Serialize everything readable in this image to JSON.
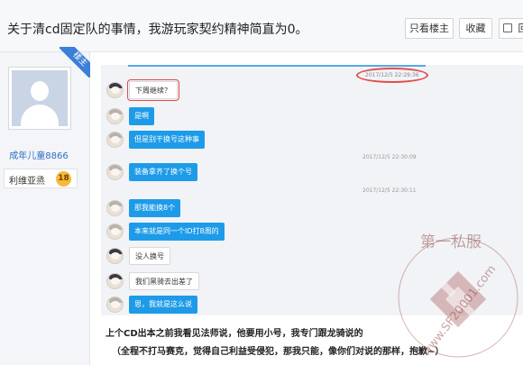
{
  "post": {
    "title": "关于清cd固定队的事情，我游玩家契约精神简直为0。"
  },
  "toolbar": {
    "only_op_label": "只看楼主",
    "favorite_label": "收藏",
    "reply_label": "回"
  },
  "user": {
    "ribbon": "楼主",
    "name": "成年儿童8866",
    "level_name": "利维亚烝",
    "level": "18"
  },
  "chat": {
    "timestamps": [
      "2017/12/5 22:29:36",
      "2017/12/5 22:30:09",
      "2017/12/5 22:30:11"
    ],
    "messages": [
      {
        "text": "下周继续？",
        "style": "white"
      },
      {
        "text": "是啊",
        "style": "blue"
      },
      {
        "text": "但是别干换号这种事",
        "style": "blue"
      },
      {
        "text": "装备拿齐了换个号",
        "style": "blue"
      },
      {
        "text": "那我能换8个",
        "style": "blue"
      },
      {
        "text": "本来就是同一个ID打8周的",
        "style": "blue"
      },
      {
        "text": "没人换号",
        "style": "white"
      },
      {
        "text": "我们黑骑去出差了",
        "style": "white"
      },
      {
        "text": "恩，我就是这么说",
        "style": "blue"
      }
    ]
  },
  "caption": {
    "line1": "上个CD出本之前我看见法师说，他要用小号，我专门跟龙骑说的",
    "line2": "（全程不打马赛克，觉得自己利益受侵犯，那我只能，像你们对说的那样，抱歉~）"
  },
  "watermark": {
    "top_text": "第一私服",
    "url_text": "www.SF20001.com"
  }
}
